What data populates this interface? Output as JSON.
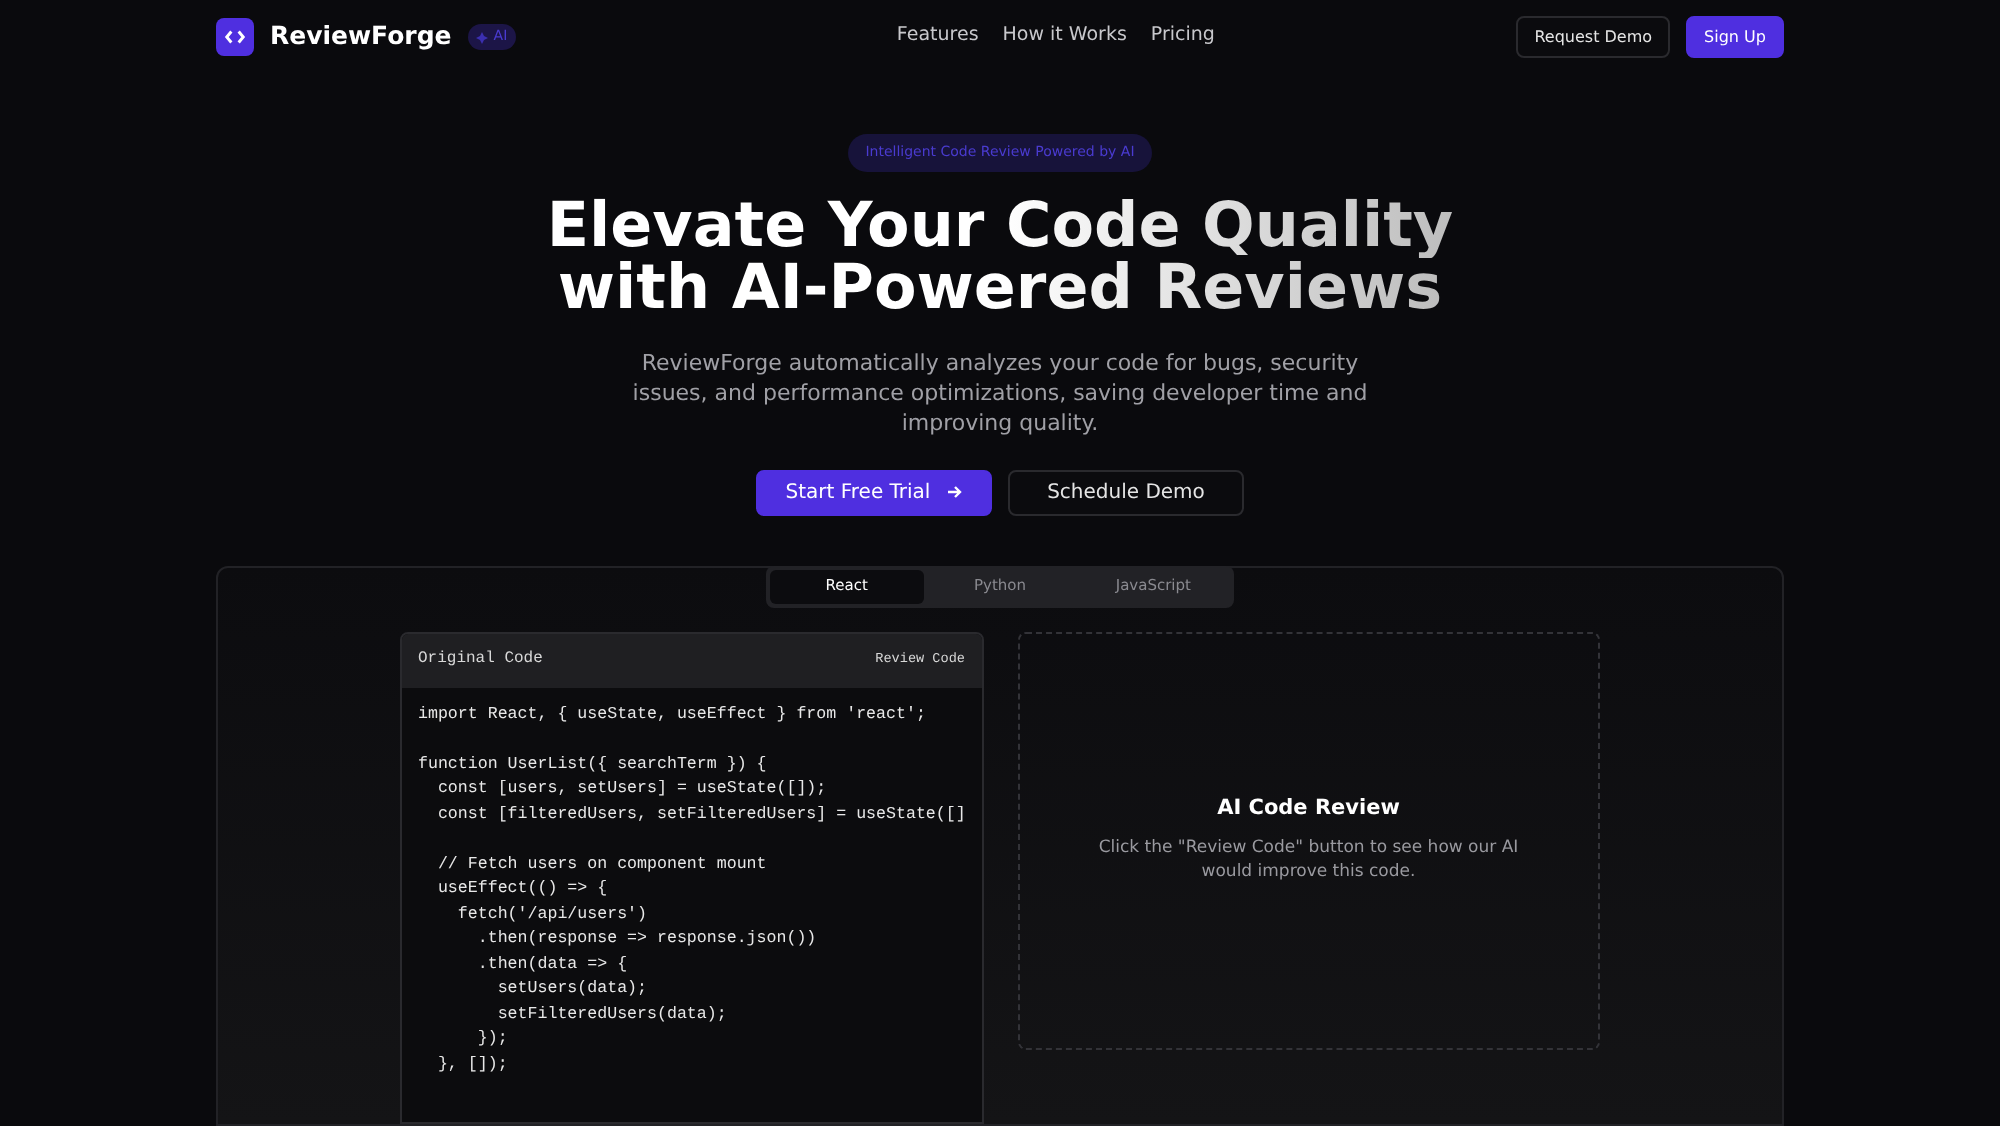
{
  "brand": {
    "name": "ReviewForge",
    "badge": "AI"
  },
  "nav": {
    "links": [
      "Features",
      "How it Works",
      "Pricing"
    ],
    "buttons": [
      {
        "label": "Request Demo",
        "kind": "outline"
      },
      {
        "label": "Sign Up",
        "kind": "primary"
      }
    ]
  },
  "hero": {
    "badge": "Intelligent Code Review Powered by AI",
    "title_lines": [
      "Elevate Your Code Quality",
      "with AI-Powered Reviews"
    ],
    "description": "ReviewForge automatically analyzes your code for bugs, security issues, and performance optimizations, saving developer time and improving quality.",
    "buttons": [
      {
        "label": "Start Free Trial",
        "kind": "primary"
      },
      {
        "label": "Schedule Demo",
        "kind": "outline"
      }
    ]
  },
  "demo": {
    "tabs": [
      {
        "label": "React",
        "selected": true
      },
      {
        "label": "Python",
        "selected": false
      },
      {
        "label": "JavaScript",
        "selected": false
      }
    ],
    "code_panel": {
      "title": "Original Code",
      "action": "Review Code",
      "blocks": [
        [
          "import React, { useState, useEffect } from 'react';"
        ],
        [
          "function UserList({ searchTerm }) {",
          "  const [users, setUsers] = useState([]);",
          "  const [filteredUsers, setFilteredUsers] = useState([]"
        ],
        [
          "  // Fetch users on component mount",
          "  useEffect(() => {",
          "    fetch('/api/users')",
          "      .then(response => response.json())",
          "      .then(data => {",
          "        setUsers(data);",
          "        setFilteredUsers(data);",
          "      });",
          "  }, []);"
        ]
      ]
    },
    "review_panel": {
      "title": "AI Code Review",
      "description": "Click the \"Review Code\" button to see how our AI would improve this code."
    }
  }
}
